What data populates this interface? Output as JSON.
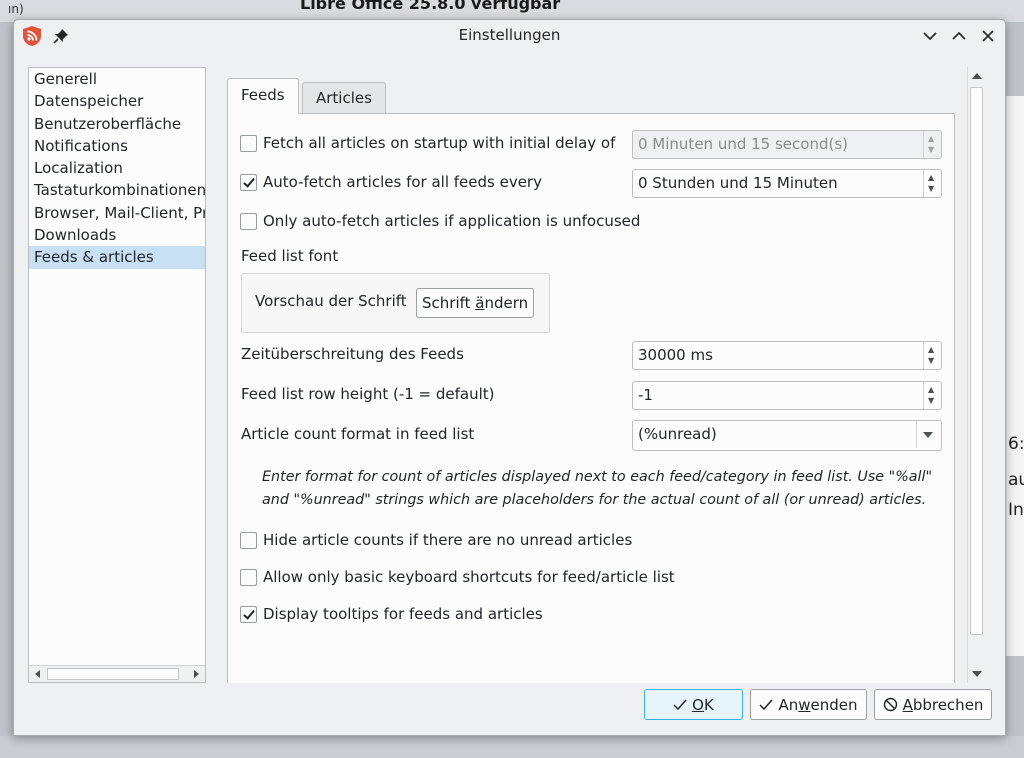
{
  "background": {
    "title": "Libre Office 25.8.0 verfügbar",
    "left_text": "ın)",
    "right_texts": [
      "6:",
      "au",
      "In"
    ]
  },
  "window": {
    "title": "Einstellungen",
    "icons": [
      "app-icon",
      "pin-icon",
      "minimize-icon",
      "maximize-icon",
      "close-icon"
    ]
  },
  "sidebar": {
    "items": [
      {
        "label": "Generell"
      },
      {
        "label": "Datenspeicher"
      },
      {
        "label": "Benutzeroberfläche"
      },
      {
        "label": "Notifications"
      },
      {
        "label": "Localization"
      },
      {
        "label": "Tastaturkombinationen"
      },
      {
        "label": "Browser, Mail-Client, Proxy"
      },
      {
        "label": "Downloads"
      },
      {
        "label": "Feeds & articles"
      }
    ],
    "selected": "Feeds & articles"
  },
  "tabs": [
    {
      "label": "Feeds",
      "active": true
    },
    {
      "label": "Articles",
      "active": false
    }
  ],
  "feeds": {
    "fetch_on_startup": {
      "label": "Fetch all articles on startup with initial delay of",
      "checked": false,
      "value": "0 Minuten und 15 second(s)",
      "enabled": false
    },
    "auto_fetch": {
      "label": "Auto-fetch articles for all feeds every",
      "checked": true,
      "value": "0 Stunden und 15 Minuten"
    },
    "auto_fetch_unfocused": {
      "label": "Only auto-fetch articles if application is unfocused",
      "checked": false
    },
    "font": {
      "label": "Feed list font",
      "preview": "Vorschau der Schrift",
      "button_pre": "Schrift ",
      "button_accel": "ä",
      "button_post": "ndern"
    },
    "timeout": {
      "label": "Zeitüberschreitung des Feeds",
      "value": "30000 ms"
    },
    "row_height": {
      "label": "Feed list row height (-1 = default)",
      "value": "-1"
    },
    "count_format": {
      "label": "Article count format in feed list",
      "value": "(%unread)"
    },
    "help_text": "Enter format for count of articles displayed next to each feed/category in feed list. Use \"%all\" and \"%unread\" strings which are placeholders for the actual count of all (or unread) articles.",
    "hide_counts": {
      "label": "Hide article counts if there are no unread articles",
      "checked": false
    },
    "basic_shortcuts": {
      "label": "Allow only basic keyboard shortcuts for feed/article list",
      "checked": false
    },
    "tooltips": {
      "label": "Display tooltips for feeds and articles",
      "checked": true
    }
  },
  "buttons": {
    "ok": {
      "accel": "O",
      "rest": "K"
    },
    "apply": {
      "pre": "An",
      "accel": "w",
      "post": "enden"
    },
    "cancel": {
      "accel": "A",
      "rest": "bbrechen"
    }
  },
  "colors": {
    "accent": "#3daee9",
    "selection": "#c7e0f4",
    "app_icon": "#e0533d"
  }
}
